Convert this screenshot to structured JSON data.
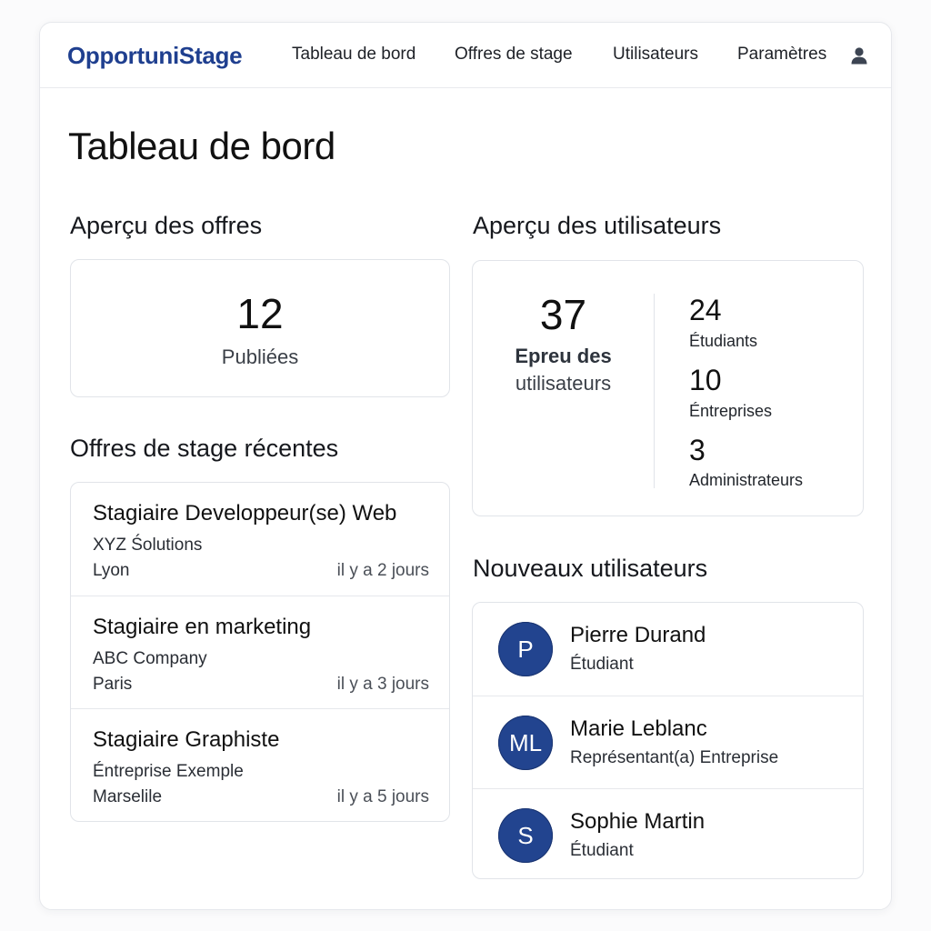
{
  "app": {
    "brand": "OpportuniStage"
  },
  "nav": {
    "items": [
      {
        "label": "Tableau de bord"
      },
      {
        "label": "Offres de stage"
      },
      {
        "label": "Utilisateurs"
      },
      {
        "label": "Paramètres"
      }
    ],
    "user_icon": "user-icon"
  },
  "page": {
    "title": "Tableau de bord"
  },
  "offers_overview": {
    "title": "Aperçu des offres",
    "count": "12",
    "label": "Publiées"
  },
  "users_overview": {
    "title": "Aperçu des utilisateurs",
    "total": "37",
    "total_label_line1": "Epreu des",
    "total_label_line2": "utilisateurs",
    "breakdown": [
      {
        "value": "24",
        "label": "Étudiants"
      },
      {
        "value": "10",
        "label": "Éntreprises"
      },
      {
        "value": "3",
        "label": "Administrateurs"
      }
    ]
  },
  "recent_offers": {
    "title": "Offres de stage récentes",
    "items": [
      {
        "title": "Stagiaire Developpeur(se) Web",
        "company": "XYZ Śolutions",
        "city": "Lyon",
        "time": "il y a 2 jours"
      },
      {
        "title": "Stagiaire en marketing",
        "company": "ABC Company",
        "city": "Paris",
        "time": "il y a 3 jours"
      },
      {
        "title": "Stagiaire Graphiste",
        "company": "Éntreprise Exemple",
        "city": "Marselile",
        "time": "il y a 5 jours"
      }
    ]
  },
  "new_users": {
    "title": "Nouveaux utilisateurs",
    "items": [
      {
        "initials": "P",
        "name": "Pierre Durand",
        "role": "Étudiant"
      },
      {
        "initials": "ML",
        "name": "Marie Leblanc",
        "role": "Représentant(a) Entreprise"
      },
      {
        "initials": "S",
        "name": "Sophie Martin",
        "role": "Étudiant"
      }
    ]
  },
  "colors": {
    "brand": "#1f3f8f",
    "avatar": "#22448f",
    "border": "#e1e4e9"
  }
}
